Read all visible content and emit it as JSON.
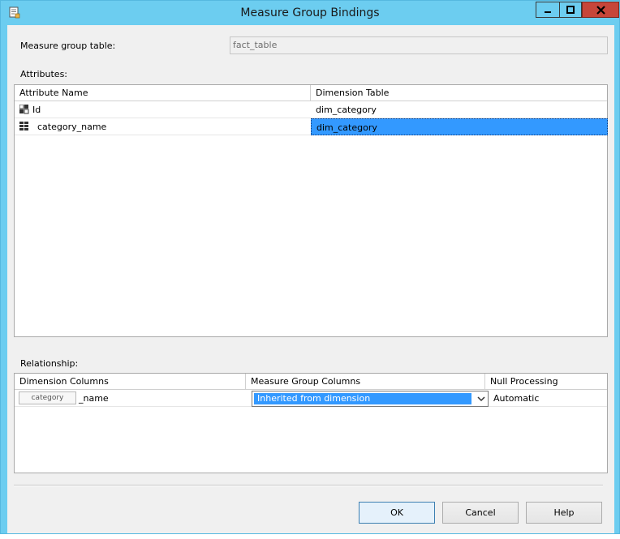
{
  "window": {
    "title": "Measure Group Bindings",
    "app_icon": "dialog-doc-icon",
    "controls": [
      "minimize-icon",
      "maximize-icon",
      "close-icon"
    ]
  },
  "measure_group": {
    "label": "Measure group table:",
    "value": "fact_table"
  },
  "attributes": {
    "label": "Attributes:",
    "columns": [
      "Attribute Name",
      "Dimension Table"
    ],
    "rows": [
      {
        "name": "Id",
        "icon": "key-attribute-icon",
        "dimension_table": "dim_category",
        "selected": false
      },
      {
        "name": "category_name",
        "icon": "attribute-icon",
        "dimension_table": "dim_category",
        "selected": true
      }
    ]
  },
  "relationship": {
    "label": "Relationship:",
    "columns": [
      "Dimension Columns",
      "Measure Group Columns",
      "Null Processing"
    ],
    "rows": [
      {
        "dimension_tag": "category",
        "dimension_suffix": "_name",
        "measure_group_column": "Inherited from dimension",
        "null_processing": "Automatic"
      }
    ]
  },
  "buttons": {
    "ok": "OK",
    "cancel": "Cancel",
    "help": "Help"
  },
  "colors": {
    "title_bar": "#6ccdf0",
    "selection": "#3399ff",
    "close_button": "#c7463a"
  }
}
